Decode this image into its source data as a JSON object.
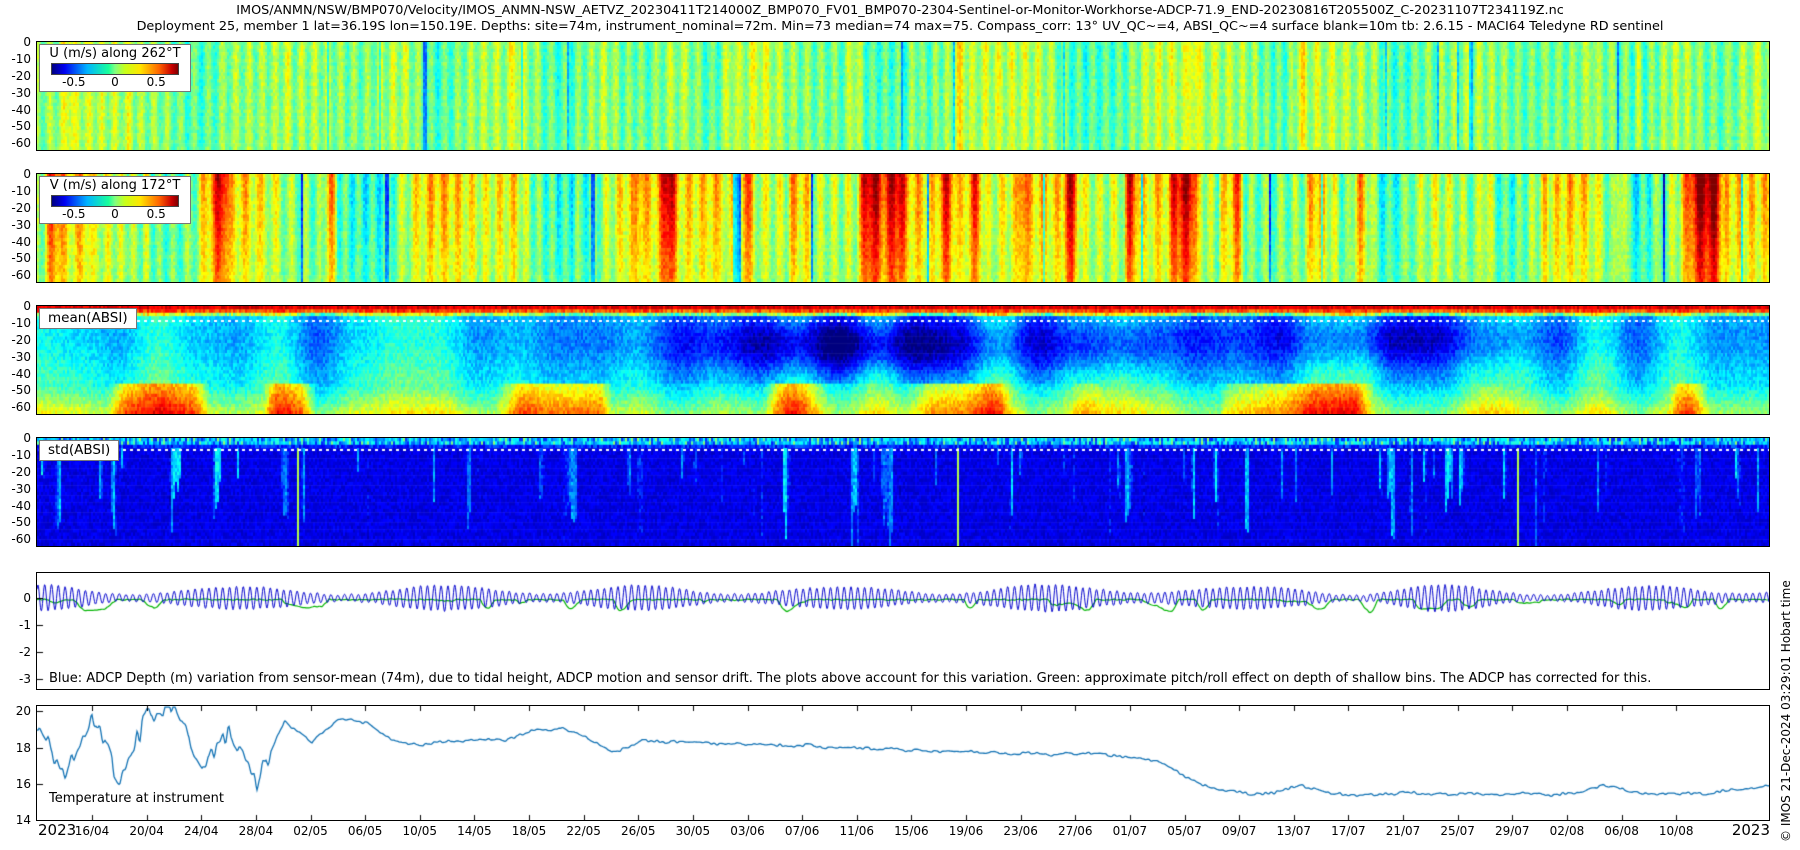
{
  "title_line1": "IMOS/ANMN/NSW/BMP070/Velocity/IMOS_ANMN-NSW_AETVZ_20230411T214000Z_BMP070_FV01_BMP070-2304-Sentinel-or-Monitor-Workhorse-ADCP-71.9_END-20230816T205500Z_C-20231107T234119Z.nc",
  "title_line2": "Deployment 25, member 1 lat=36.19S lon=150.19E. Depths: site=74m, instrument_nominal=72m. Min=73 median=74 max=75. Compass_corr: 13° UV_QC~=4, ABSI_QC~=4 surface blank=10m tb: 2.6.15 - MACI64 Teledyne RD sentinel",
  "watermark": "© IMOS 21-Dec-2024 03:29:01 Hobart time",
  "x_axis": {
    "year_left": "2023",
    "year_right": "2023",
    "tick_labels": [
      "16/04",
      "20/04",
      "24/04",
      "28/04",
      "02/05",
      "06/05",
      "10/05",
      "14/05",
      "18/05",
      "22/05",
      "26/05",
      "30/05",
      "03/06",
      "07/06",
      "11/06",
      "15/06",
      "19/06",
      "23/06",
      "27/06",
      "01/07",
      "05/07",
      "09/07",
      "13/07",
      "17/07",
      "21/07",
      "25/07",
      "29/07",
      "02/08",
      "06/08",
      "10/08"
    ],
    "first_tick_day_offset": 4.1,
    "tick_interval_days": 4,
    "span_days": 126.97
  },
  "chart_data": [
    {
      "type": "heatmap",
      "id": "u_velocity",
      "label": "U (m/s) along 262°T",
      "colormap": "jet",
      "colorbar_ticks": [
        "-0.5",
        "0",
        "0.5"
      ],
      "ylim": [
        -64,
        0
      ],
      "yticks": [
        0,
        -10,
        -20,
        -30,
        -40,
        -50,
        -60
      ],
      "description": "Cross-shore velocity vs depth and time; mostly near-zero (green) with fine vertical tidal striping and intermittent yellow/cyan bands over the full water column.",
      "texture": {
        "style": "velocity",
        "seed": 11,
        "base": 0.01,
        "tideAmp": 0.1,
        "tideFreq": 0.95,
        "lowAmp": 0.11,
        "lowScale": 0.05,
        "jitter": 0.12,
        "depthFade": 0.2,
        "climSpan": 1.4,
        "eventThresh": 0.8,
        "eventAmp": 0.9,
        "negSpike": 0.25
      }
    },
    {
      "type": "heatmap",
      "id": "v_velocity",
      "label": "V (m/s) along 172°T",
      "colormap": "jet",
      "colorbar_ticks": [
        "-0.5",
        "0",
        "0.5"
      ],
      "ylim": [
        -64,
        0
      ],
      "yticks": [
        0,
        -10,
        -20,
        -30,
        -40,
        -50,
        -60
      ],
      "description": "Alongshore velocity vs depth and time; energetic, with repeated strong southward (orange/red) events surface-intensified, and occasional narrow blue (negative) columns.",
      "texture": {
        "style": "velocity",
        "seed": 23,
        "base": 0.05,
        "tideAmp": 0.13,
        "tideFreq": 0.9,
        "lowAmp": 0.26,
        "lowScale": 0.03,
        "jitter": 0.12,
        "depthFade": 0.4,
        "climSpan": 1.4,
        "eventThresh": 0.62,
        "eventAmp": 1.4,
        "negSpike": 0.5
      }
    },
    {
      "type": "heatmap",
      "id": "mean_absi",
      "label": "mean(ABSI)",
      "colormap": "jet",
      "ylim": [
        -64,
        0
      ],
      "yticks": [
        0,
        -10,
        -20,
        -30,
        -40,
        -50,
        -60
      ],
      "description": "Mean acoustic backscatter: strong red/orange band in the top ~6 m, white dotted bin-depth line near -8 m, cyan/blue interior with a dark-blue low-backscatter pool centred around mid-June at 10-45 m, greener/yellower values near the seabed.",
      "texture": {
        "style": "absi-mean",
        "seed": 37,
        "dotline": 0.13
      }
    },
    {
      "type": "heatmap",
      "id": "std_absi",
      "label": "std(ABSI)",
      "colormap": "jet",
      "ylim": [
        -64,
        0
      ],
      "yticks": [
        0,
        -10,
        -20,
        -30,
        -40,
        -50,
        -60
      ],
      "description": "Backscatter standard deviation: bright cyan band in the top bins with a white dotted line, dark navy blue elsewhere with sparse brighter vertical streaks and rare green columns.",
      "texture": {
        "style": "absi-std",
        "seed": 53,
        "dotline": 0.1
      }
    },
    {
      "type": "line",
      "id": "depth_variation",
      "ylim": [
        -3.4,
        0.95
      ],
      "yticks": [
        0,
        -1,
        -2,
        -3
      ],
      "annotation": "Blue: ADCP Depth (m) variation from sensor-mean (74m), due to tidal height, ADCP motion and sensor drift. The plots above account for this variation. Green: approximate pitch/roll effect on depth of shallow bins. The ADCP has corrected for this.",
      "series": [
        {
          "name": "adcp-depth-variation",
          "color": "#0000cc",
          "description": "semidiurnal tidal oscillation of roughly ±0.3-0.5 m about zero with spring-neap modulation for the whole record"
        },
        {
          "name": "pitch-roll-effect",
          "color": "#00b400",
          "description": "nearly flat line just below zero with occasional small downward excursions"
        }
      ]
    },
    {
      "type": "line",
      "id": "temperature",
      "label": "Temperature at instrument",
      "color": "#1272b4",
      "ylim": [
        14,
        20.3
      ],
      "ytop": 20.3,
      "yticks": [
        20,
        18,
        16,
        14
      ],
      "values": [
        19.4,
        16.3,
        20.0,
        16.2,
        19.8,
        20.1,
        17.2,
        19.0,
        16.0,
        19.5,
        18.3,
        19.6,
        19.4,
        18.3,
        18.2,
        18.3,
        18.5,
        18.4,
        18.9,
        19.1,
        18.5,
        17.7,
        18.4,
        18.3,
        18.3,
        18.2,
        18.2,
        18.1,
        18.1,
        18.0,
        18.0,
        17.9,
        17.9,
        17.8,
        17.8,
        17.7,
        17.7,
        17.6,
        17.7,
        17.6,
        17.4,
        17.2,
        16.2,
        15.6,
        15.5,
        15.5,
        15.9,
        15.5,
        15.4,
        15.5,
        15.5,
        15.4,
        15.5,
        15.4,
        15.5,
        15.4,
        15.5,
        16.0,
        15.5,
        15.4,
        15.5,
        15.5,
        15.7,
        15.9
      ],
      "description": "Temperature (°C) at instrument: chaotic 16-20 °C swings in mid-late April, settling near 18.2-18.5 °C in May, slow decline through June, sharp drop to ~15.5 °C at the start of July, then flat ~15.4-15.6 °C with small bumps to mid-August."
    }
  ]
}
